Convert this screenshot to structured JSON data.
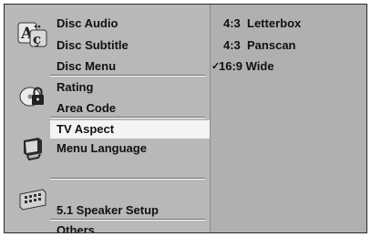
{
  "menu": {
    "groups": [
      {
        "icon": "language-icon",
        "items": [
          "Disc Audio",
          "Disc Subtitle",
          "Disc Menu"
        ]
      },
      {
        "icon": "lock-disc-icon",
        "items": [
          "Rating",
          "Area Code"
        ]
      },
      {
        "icon": "tv-icon",
        "items": [
          "TV Aspect",
          "Menu Language"
        ]
      },
      {
        "icon": "speaker-icon",
        "items": [
          "5.1 Speaker Setup"
        ]
      }
    ],
    "others_label": "Others",
    "selected": "TV Aspect"
  },
  "options": {
    "items": [
      "4:3  Letterbox",
      "4:3  Panscan",
      "16:9 Wide"
    ],
    "checked": "16:9 Wide",
    "check_mark": "✓"
  },
  "colors": {
    "panel": "#b8b8b8",
    "highlight": "#f4f4f4",
    "text": "#111111"
  }
}
